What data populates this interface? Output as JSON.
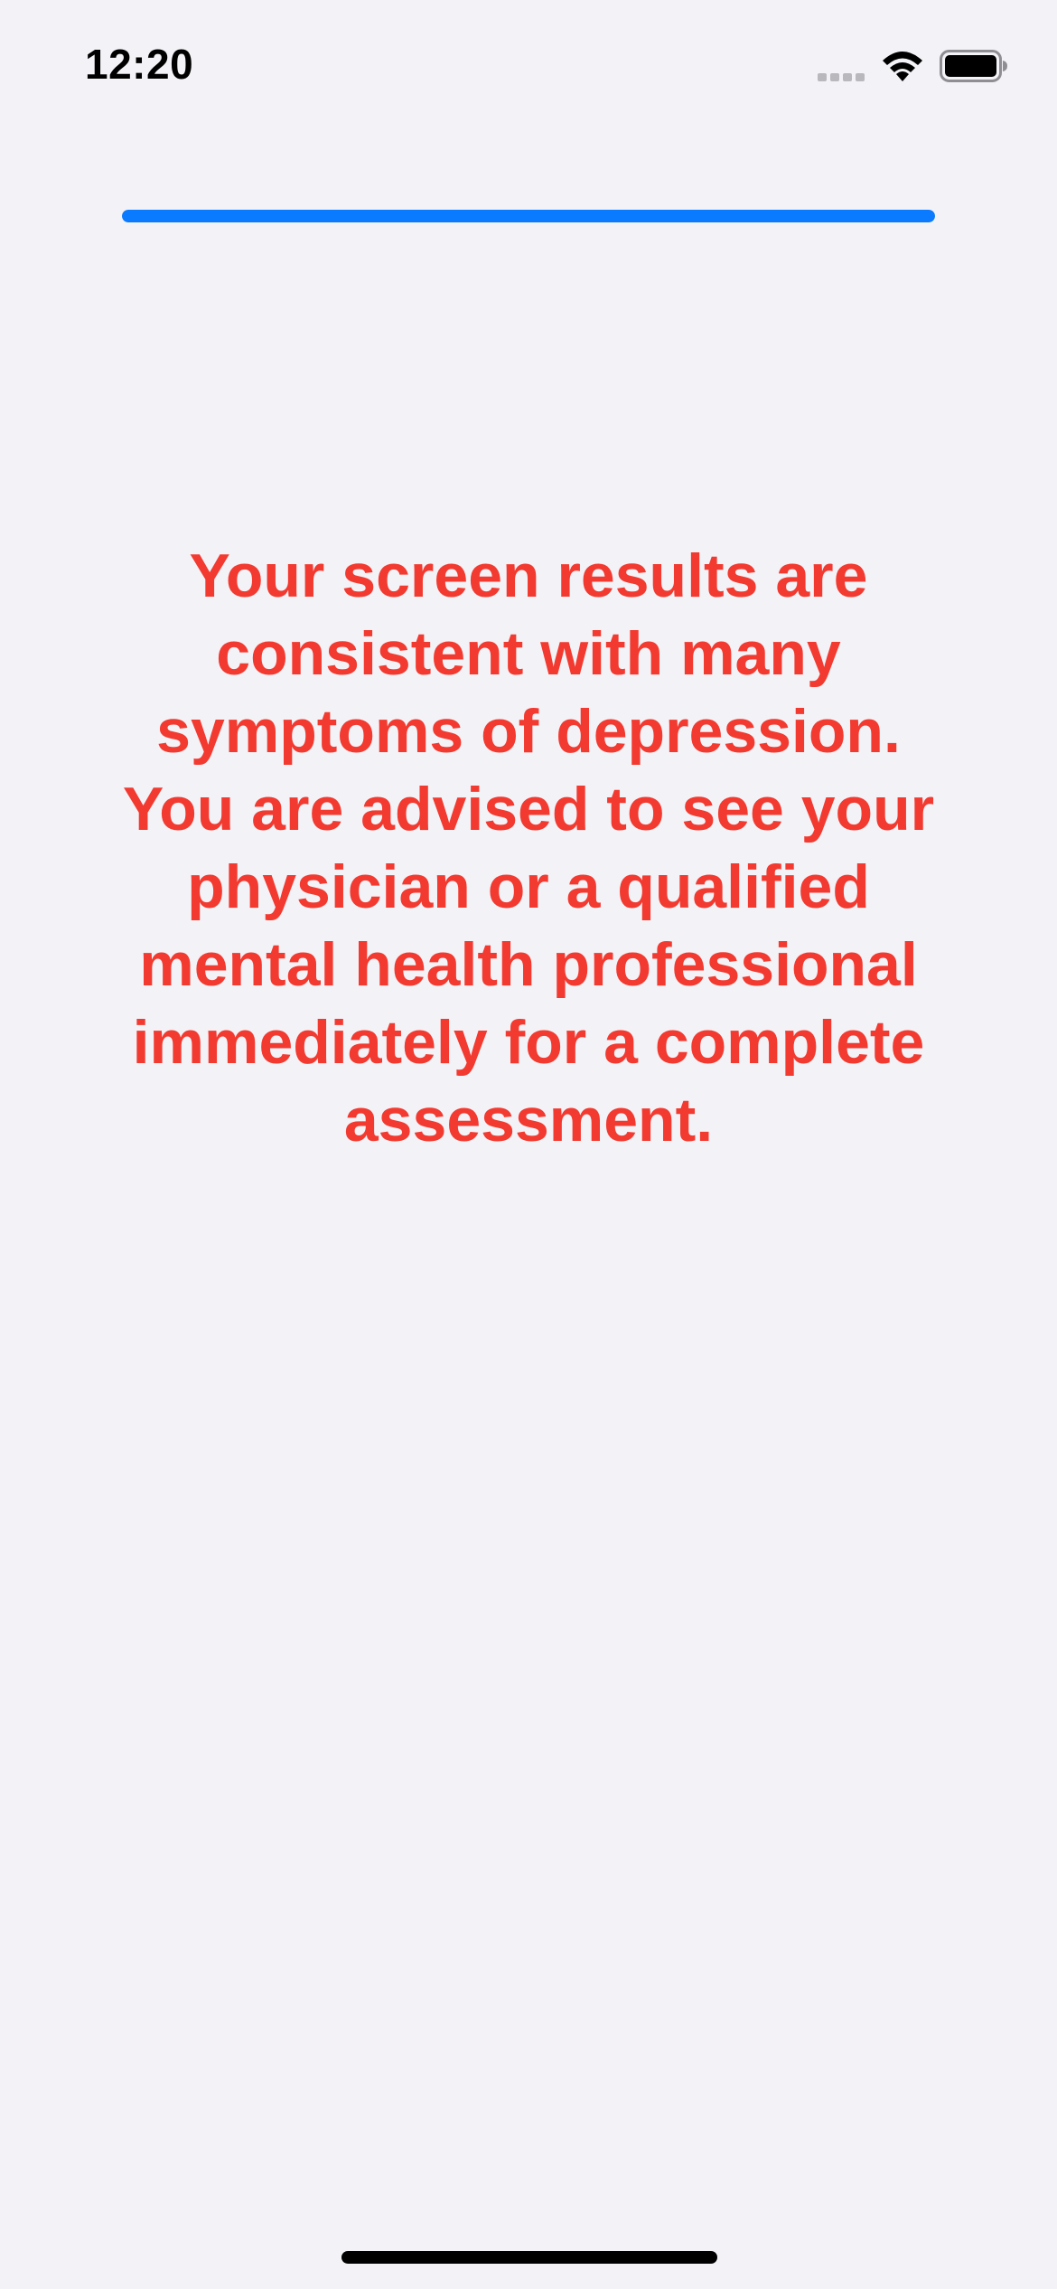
{
  "status_bar": {
    "time": "12:20",
    "icons": [
      "cellular-signal-icon",
      "wifi-icon",
      "battery-icon"
    ]
  },
  "progress": {
    "value_percent": 100,
    "color": "#0a7aff"
  },
  "result": {
    "message": "Your screen results are consistent with many symptoms of depression. You are advised to see your physician or a qualified mental health professional immediately for a complete assessment.",
    "color": "#f23a30"
  },
  "colors": {
    "background": "#f2f2f7"
  }
}
